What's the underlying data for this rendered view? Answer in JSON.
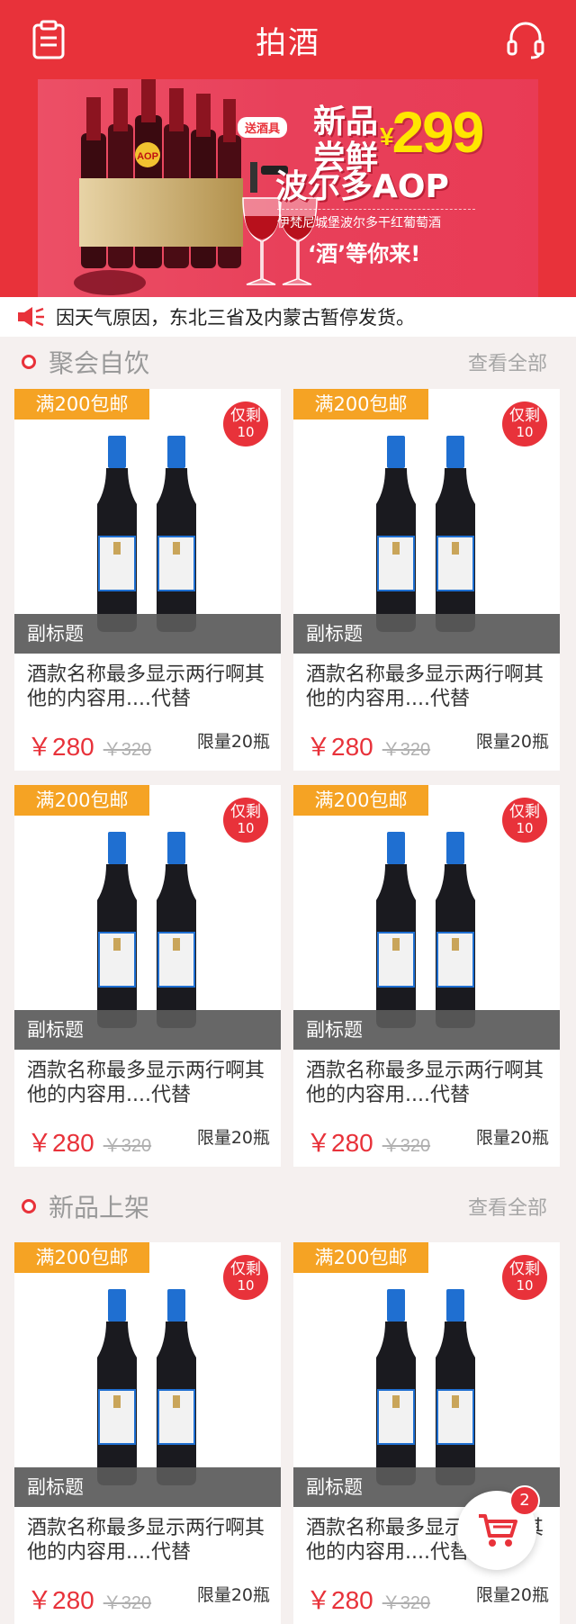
{
  "header": {
    "title": "拍酒",
    "left_icon": "clipboard-icon",
    "right_icon": "headset-icon"
  },
  "banner": {
    "gift_tag": "送酒具",
    "headline_line1": "新品",
    "headline_line2": "尝鲜",
    "price_currency": "¥",
    "price": "299",
    "subline": "波尔多AOP",
    "description": "伊梵尼城堡波尔多干红葡萄酒",
    "slogan": "‘酒’等你来!",
    "medal": "AOP"
  },
  "notice": {
    "icon": "speaker-icon",
    "text": "因天气原因，东北三省及内蒙古暂停发货。"
  },
  "sections": [
    {
      "title": "聚会自饮",
      "more": "查看全部"
    },
    {
      "title": "新品上架",
      "more": "查看全部"
    }
  ],
  "product": {
    "ship_tag": "满200包邮",
    "stock_line1": "仅剩",
    "stock_line2": "10",
    "subtitle": "副标题",
    "name": "酒款名称最多显示两行啊其他的内容用....代替",
    "price_now": "￥280",
    "price_old": "￥320",
    "limit": "限量20瓶"
  },
  "cart": {
    "icon": "cart-icon",
    "count": "2"
  },
  "colors": {
    "primary": "#e8323a",
    "ship_tag": "#f5a324"
  }
}
